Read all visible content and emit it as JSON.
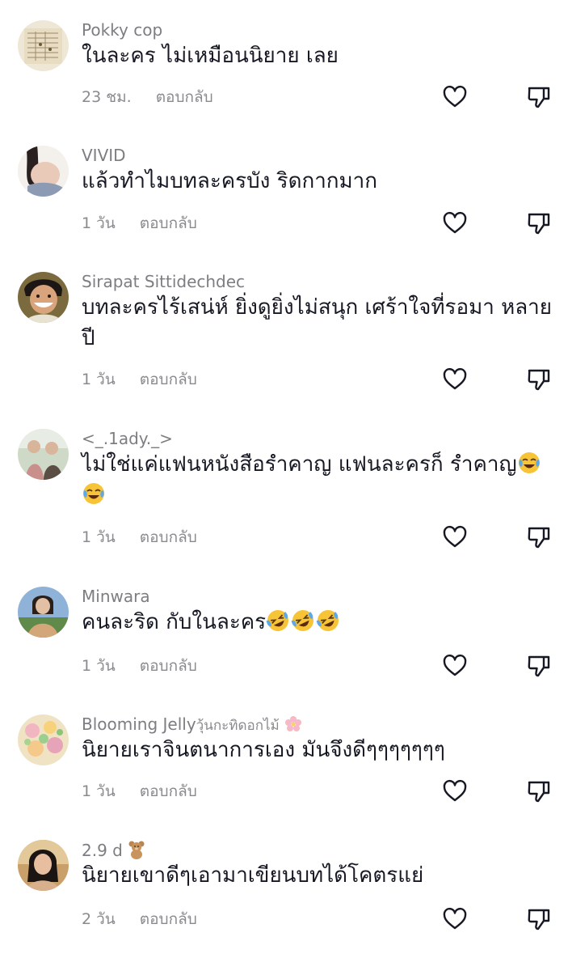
{
  "comments": [
    {
      "username": "Pokky cop",
      "username_suffix": "",
      "username_emoji": "",
      "text": "ในละคร ไม่เหมือนนิยาย เลย",
      "emoji_icons": [],
      "time": "23 ชม.",
      "reply_label": "ตอบกลับ"
    },
    {
      "username": "VIVID",
      "username_suffix": "",
      "username_emoji": "",
      "text": "แล้วทำไมบทละครบัง ริดกากมาก",
      "emoji_icons": [],
      "time": "1 วัน",
      "reply_label": "ตอบกลับ"
    },
    {
      "username": "Sirapat Sittidechdec",
      "username_suffix": "",
      "username_emoji": "",
      "text": "บทละครไร้เสน่ห์ ยิ่งดูยิ่งไม่สนุก เศร้าใจที่รอมา หลายปี",
      "emoji_icons": [],
      "time": "1 วัน",
      "reply_label": "ตอบกลับ"
    },
    {
      "username": "<_.1ady._>",
      "username_suffix": "",
      "username_emoji": "",
      "text": "ไม่ใช่แค่แฟนหนังสือรำคาญ แฟนละครก็ รำคาญ",
      "emoji_icons": [
        "tears-of-joy-emoji",
        "tears-of-joy-emoji"
      ],
      "time": "1 วัน",
      "reply_label": "ตอบกลับ"
    },
    {
      "username": "Minwara",
      "username_suffix": "",
      "username_emoji": "",
      "text": "คนละริด กับในละคร",
      "emoji_icons": [
        "rolling-laughing-emoji",
        "rolling-laughing-emoji",
        "rolling-laughing-emoji"
      ],
      "time": "1 วัน",
      "reply_label": "ตอบกลับ"
    },
    {
      "username": "Blooming Jelly",
      "username_suffix": "วุ้นกะทิดอกไม้",
      "username_emoji": "cherry-blossom-emoji",
      "text": "นิยายเราจินตนาการเอง มันจึงดีๆๆๆๆๆๆๆ",
      "emoji_icons": [],
      "time": "1 วัน",
      "reply_label": "ตอบกลับ"
    },
    {
      "username": "2.9 d",
      "username_suffix": "",
      "username_emoji": "teddy-bear-emoji",
      "text": "นิยายเขาดีๆเอามาเขียนบทได้โคตรแย่",
      "emoji_icons": [],
      "time": "2 วัน",
      "reply_label": "ตอบกลับ"
    }
  ],
  "icons": {
    "like": "heart-outline-icon",
    "dislike": "thumbs-down-outline-icon"
  },
  "colors": {
    "username": "#7d7d82",
    "text": "#161823",
    "meta": "#8a8a8f",
    "icon": "#161823"
  }
}
